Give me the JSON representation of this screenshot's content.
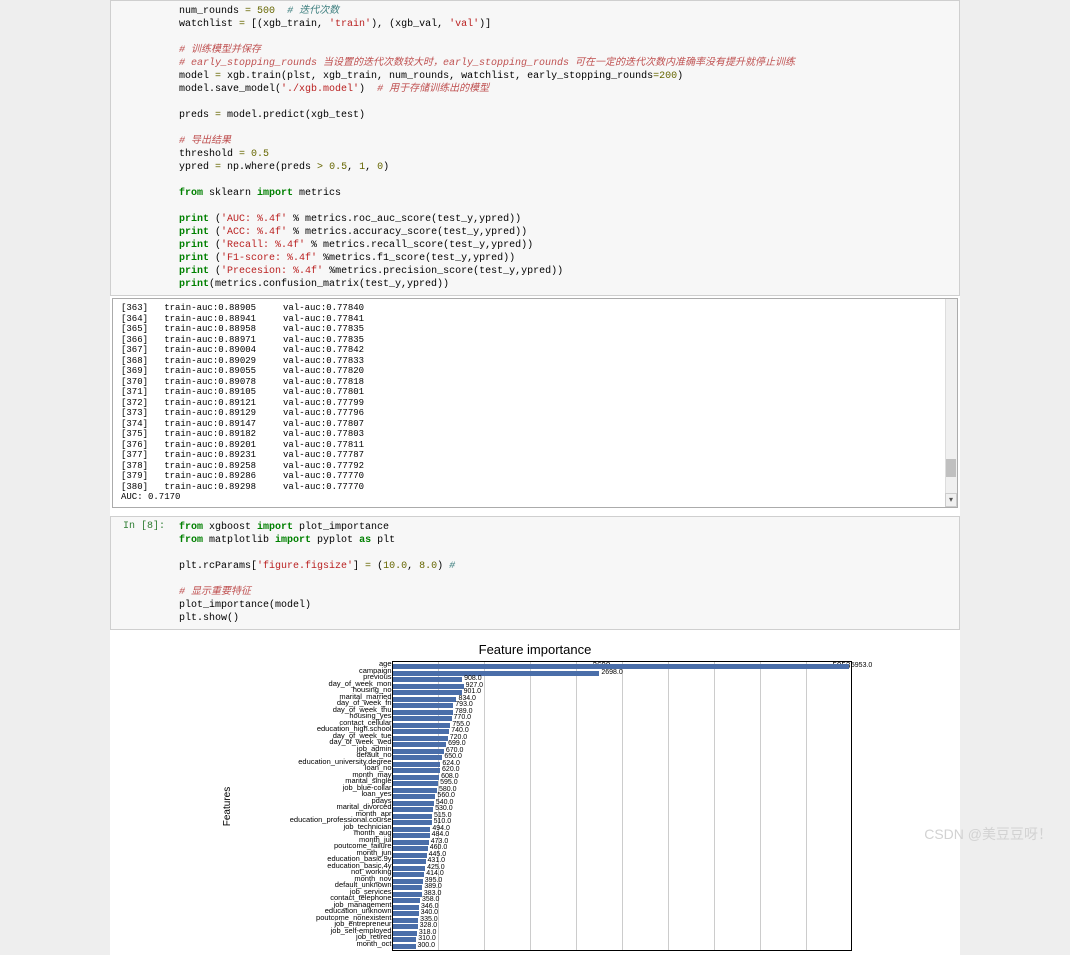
{
  "code1": {
    "l1a": "num_rounds ",
    "l1b": "=",
    "l1c": " ",
    "l1d": "500",
    "l1e": "  # 迭代次数",
    "l2a": "watchlist ",
    "l2b": "=",
    "l2c": " [(xgb_train, ",
    "l2d": "'train'",
    "l2e": "), (xgb_val, ",
    "l2f": "'val'",
    "l2g": ")]",
    "l3": "# 训练模型并保存",
    "l4": "# early_stopping_rounds 当设置的迭代次数较大时，early_stopping_rounds 可在一定的迭代次数内准确率没有提升就停止训练",
    "l5a": "model ",
    "l5b": "=",
    "l5c": " xgb.train(plst, xgb_train, num_rounds, watchlist, early_stopping_rounds",
    "l5d": "=",
    "l5e": "200",
    "l5f": ")",
    "l6a": "model.save_model(",
    "l6b": "'./xgb.model'",
    "l6c": ")  ",
    "l6d": "# 用于存储训练出的模型",
    "l7a": "preds ",
    "l7b": "=",
    "l7c": " model.predict(xgb_test)",
    "l8": "# 导出结果",
    "l9a": "threshold ",
    "l9b": "=",
    "l9c": " ",
    "l9d": "0.5",
    "l10a": "ypred ",
    "l10b": "=",
    "l10c": " np.where(preds ",
    "l10d": ">",
    "l10e": " ",
    "l10f": "0.5",
    "l10g": ", ",
    "l10h": "1",
    "l10i": ", ",
    "l10j": "0",
    "l10k": ")",
    "l11a": "from",
    "l11b": " sklearn ",
    "l11c": "import",
    "l11d": " metrics",
    "l12a": "print",
    "l12b": " (",
    "l12c": "'AUC: %.4f'",
    "l12d": " % metrics.roc_auc_score(test_y,ypred))",
    "l13a": "print",
    "l13b": " (",
    "l13c": "'ACC: %.4f'",
    "l13d": " % metrics.accuracy_score(test_y,ypred))",
    "l14a": "print",
    "l14b": " (",
    "l14c": "'Recall: %.4f'",
    "l14d": " % metrics.recall_score(test_y,ypred))",
    "l15a": "print",
    "l15b": " (",
    "l15c": "'F1-score: %.4f'",
    "l15d": " %metrics.f1_score(test_y,ypred))",
    "l16a": "print",
    "l16b": " (",
    "l16c": "'Precesion: %.4f'",
    "l16d": " %metrics.precision_score(test_y,ypred))",
    "l17a": "print",
    "l17b": "(metrics.confusion_matrix(test_y,ypred))"
  },
  "output_rows": [
    [
      "[363]",
      "train-auc:0.88905",
      "val-auc:0.77840"
    ],
    [
      "[364]",
      "train-auc:0.88941",
      "val-auc:0.77841"
    ],
    [
      "[365]",
      "train-auc:0.88958",
      "val-auc:0.77835"
    ],
    [
      "[366]",
      "train-auc:0.88971",
      "val-auc:0.77835"
    ],
    [
      "[367]",
      "train-auc:0.89004",
      "val-auc:0.77842"
    ],
    [
      "[368]",
      "train-auc:0.89029",
      "val-auc:0.77833"
    ],
    [
      "[369]",
      "train-auc:0.89055",
      "val-auc:0.77820"
    ],
    [
      "[370]",
      "train-auc:0.89078",
      "val-auc:0.77818"
    ],
    [
      "[371]",
      "train-auc:0.89105",
      "val-auc:0.77801"
    ],
    [
      "[372]",
      "train-auc:0.89121",
      "val-auc:0.77799"
    ],
    [
      "[373]",
      "train-auc:0.89129",
      "val-auc:0.77796"
    ],
    [
      "[374]",
      "train-auc:0.89147",
      "val-auc:0.77807"
    ],
    [
      "[375]",
      "train-auc:0.89182",
      "val-auc:0.77803"
    ],
    [
      "[376]",
      "train-auc:0.89201",
      "val-auc:0.77811"
    ],
    [
      "[377]",
      "train-auc:0.89231",
      "val-auc:0.77787"
    ],
    [
      "[378]",
      "train-auc:0.89258",
      "val-auc:0.77792"
    ],
    [
      "[379]",
      "train-auc:0.89286",
      "val-auc:0.77770"
    ],
    [
      "[380]",
      "train-auc:0.89298",
      "val-auc:0.77770"
    ]
  ],
  "output_auc": "AUC: 0.7170",
  "cell2_prompt": "In  [8]:",
  "code2": {
    "l1a": "from",
    "l1b": " xgboost ",
    "l1c": "import",
    "l1d": " plot_importance",
    "l2a": "from",
    "l2b": " matplotlib ",
    "l2c": "import",
    "l2d": " pyplot ",
    "l2e": "as",
    "l2f": " plt",
    "l3a": "plt.rcParams[",
    "l3b": "'figure.figsize'",
    "l3c": "] ",
    "l3d": "=",
    "l3e": " (",
    "l3f": "10.0",
    "l3g": ", ",
    "l3h": "8.0",
    "l3i": ") ",
    "l3j": "#",
    "l4": "# 显示重要特征",
    "l5": "plot_importance(model)",
    "l6": "plt.show()"
  },
  "chart_data": {
    "type": "bar",
    "title": "Feature importance",
    "ylabel": "Features",
    "xlim": [
      0,
      6000
    ],
    "top_ticks": [
      2698.0,
      5953.0
    ],
    "categories": [
      "age",
      "campaign",
      "previous",
      "day_of_week_mon",
      "housing_no",
      "marital_married",
      "day_of_week_fri",
      "day_of_week_thu",
      "housing_yes",
      "contact_cellular",
      "education_high.school",
      "day_of_week_tue",
      "day_of_week_wed",
      "job_admin",
      "default_no",
      "education_university.degree",
      "loan_no",
      "month_may",
      "marital_single",
      "job_blue-collar",
      "loan_yes",
      "pdays",
      "marital_divorced",
      "month_apr",
      "education_professional.course",
      "job_technician",
      "month_aug",
      "month_jul",
      "poutcome_failure",
      "month_jun",
      "education_basic.9y",
      "education_basic.4y",
      "not_working",
      "month_nov",
      "default_unknown",
      "job_services",
      "contact_telephone",
      "job_management",
      "education_unknown",
      "poutcome_nonexistent",
      "job_entrepreneur",
      "job_self-employed",
      "job_retired",
      "month_oct"
    ],
    "values": [
      5953,
      2698,
      908,
      927,
      901,
      834,
      793,
      789,
      770,
      755,
      740,
      720,
      699,
      670,
      650,
      624,
      620,
      608,
      595,
      580,
      560,
      540,
      530,
      515,
      510,
      494,
      484,
      473,
      460,
      445,
      431,
      425,
      414,
      395,
      389,
      383,
      358,
      346,
      340,
      335,
      328,
      318,
      310,
      300
    ]
  },
  "watermark": "CSDN @美豆豆呀！"
}
